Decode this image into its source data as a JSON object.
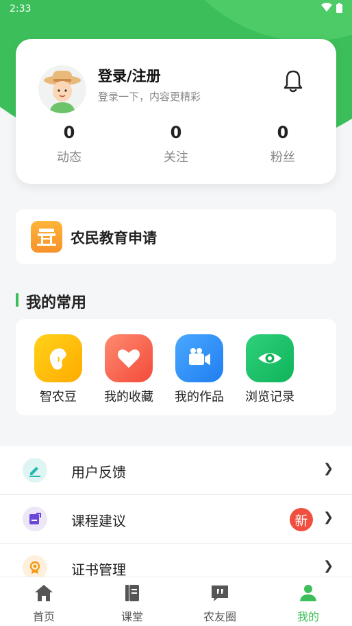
{
  "status_bar": {
    "time": "2:33"
  },
  "profile": {
    "title": "登录/注册",
    "subtitle": "登录一下，内容更精彩",
    "stats": [
      {
        "value": "0",
        "label": "动态"
      },
      {
        "value": "0",
        "label": "关注"
      },
      {
        "value": "0",
        "label": "粉丝"
      }
    ]
  },
  "edu_application": {
    "label": "农民教育申请",
    "icon": "farmer-stand-icon"
  },
  "favorites": {
    "title": "我的常用",
    "items": [
      {
        "label": "智农豆",
        "icon": "bean-icon"
      },
      {
        "label": "我的收藏",
        "icon": "heart-icon"
      },
      {
        "label": "我的作品",
        "icon": "video-camera-icon"
      },
      {
        "label": "浏览记录",
        "icon": "eye-icon"
      }
    ]
  },
  "menu": [
    {
      "label": "用户反馈",
      "icon": "pencil-icon"
    },
    {
      "label": "课程建议",
      "icon": "edit-note-icon",
      "badge": "新"
    },
    {
      "label": "证书管理",
      "icon": "medal-icon"
    }
  ],
  "tabbar": [
    {
      "label": "首页",
      "icon": "home-icon"
    },
    {
      "label": "课堂",
      "icon": "book-icon"
    },
    {
      "label": "农友圈",
      "icon": "quote-bubble-icon"
    },
    {
      "label": "我的",
      "icon": "person-icon",
      "active": true
    }
  ],
  "colors": {
    "accent": "#3cbf5a",
    "badge": "#f04e3e"
  }
}
